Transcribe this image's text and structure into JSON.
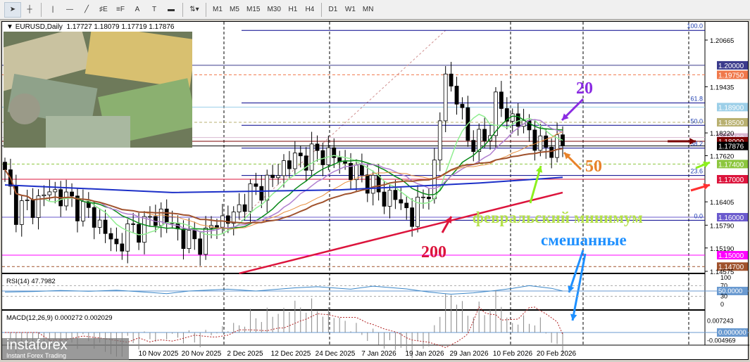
{
  "toolbar": {
    "tools": [
      {
        "name": "cursor",
        "glyph": "➤"
      },
      {
        "name": "crosshair",
        "glyph": "┼"
      },
      {
        "name": "vertical-line",
        "glyph": "|"
      },
      {
        "name": "horizontal-line",
        "glyph": "—"
      },
      {
        "name": "trendline",
        "glyph": "╱"
      },
      {
        "name": "fibo-channel",
        "glyph": "♯E"
      },
      {
        "name": "fibo-levels",
        "glyph": "≡F"
      },
      {
        "name": "text",
        "glyph": "A"
      },
      {
        "name": "text-label",
        "glyph": "T"
      },
      {
        "name": "rectangle",
        "glyph": "▬"
      },
      {
        "name": "arrows",
        "glyph": "⇅▾"
      }
    ],
    "timeframes": [
      "M1",
      "M5",
      "M15",
      "M30",
      "H1",
      "H4",
      "D1",
      "W1",
      "MN"
    ]
  },
  "symbol": {
    "label": "EURUSD,Daily",
    "open": "1.17727",
    "high": "1.18079",
    "low": "1.17719",
    "close": "1.17876"
  },
  "price_axis": {
    "ticks": [
      "1.20665",
      "1.19435",
      "1.18220",
      "1.17620",
      "1.16405",
      "1.15790",
      "1.15190",
      "1.14575"
    ],
    "min": 1.14575,
    "max": 1.20665
  },
  "levels": [
    {
      "price": 1.2,
      "label": "1.20000",
      "color": "#3b3b8c",
      "style": "solid"
    },
    {
      "price": 1.1975,
      "label": "1.19750",
      "color": "#f0784a",
      "style": "dash"
    },
    {
      "price": 1.189,
      "label": "1.18900",
      "color": "#9ccfe8",
      "style": "solid"
    },
    {
      "price": 1.185,
      "label": "1.18500",
      "color": "#b8b070",
      "style": "dash"
    },
    {
      "price": 1.181,
      "label": "1.18100",
      "color": "#d8b8d0",
      "style": "solid"
    },
    {
      "price": 1.18,
      "label": "1.18000",
      "color": "#7a0000",
      "style": "solid"
    },
    {
      "price": 1.17876,
      "label": "1.17876",
      "color": "#000000",
      "style": "solid"
    },
    {
      "price": 1.174,
      "label": "1.17400",
      "color": "#8cc63e",
      "style": "dash"
    },
    {
      "price": 1.17,
      "label": "1.17000",
      "color": "#dc143c",
      "style": "solid"
    },
    {
      "price": 1.16,
      "label": "1.16000",
      "color": "#6a5acd",
      "style": "solid"
    },
    {
      "price": 1.15,
      "label": "1.15000",
      "color": "#ff00ff",
      "style": "solid"
    },
    {
      "price": 1.147,
      "label": "1.14700",
      "color": "#a0522d",
      "style": "dash"
    }
  ],
  "fibo": [
    {
      "label": "100.0",
      "price": 1.2092
    },
    {
      "label": "61.8",
      "price": 1.1901
    },
    {
      "label": "50.0",
      "price": 1.1842
    },
    {
      "label": "38.2",
      "price": 1.1782
    },
    {
      "label": "23.6",
      "price": 1.171
    },
    {
      "label": "0.0",
      "price": 1.1592
    }
  ],
  "price_path": [
    [
      0,
      1.171
    ],
    [
      2,
      1.162
    ],
    [
      5,
      1.163
    ],
    [
      8,
      1.167
    ],
    [
      12,
      1.164
    ],
    [
      16,
      1.16
    ],
    [
      20,
      1.152
    ],
    [
      22,
      1.156
    ],
    [
      25,
      1.158
    ],
    [
      28,
      1.161
    ],
    [
      31,
      1.156
    ],
    [
      34,
      1.153
    ],
    [
      36,
      1.155
    ],
    [
      38,
      1.159
    ],
    [
      41,
      1.16
    ],
    [
      43,
      1.165
    ],
    [
      48,
      1.17
    ],
    [
      50,
      1.174
    ],
    [
      54,
      1.176
    ],
    [
      57,
      1.177
    ],
    [
      60,
      1.175
    ],
    [
      62,
      1.172
    ],
    [
      65,
      1.17
    ],
    [
      67,
      1.166
    ],
    [
      70,
      1.165
    ],
    [
      72,
      1.162
    ],
    [
      73,
      1.16
    ],
    [
      75,
      1.165
    ],
    [
      77,
      1.172
    ],
    [
      78,
      1.185
    ],
    [
      79,
      1.2
    ],
    [
      80,
      1.193
    ],
    [
      82,
      1.188
    ],
    [
      83,
      1.18
    ],
    [
      86,
      1.18
    ],
    [
      88,
      1.19
    ],
    [
      90,
      1.187
    ],
    [
      92,
      1.185
    ],
    [
      94,
      1.183
    ],
    [
      96,
      1.178
    ],
    [
      98,
      1.179
    ],
    [
      100,
      1.17876
    ]
  ],
  "ma200": [
    [
      42,
      1.1452
    ],
    [
      100,
      1.1665
    ]
  ],
  "ma100": [
    [
      0,
      1.1685
    ],
    [
      30,
      1.1665
    ],
    [
      60,
      1.1672
    ],
    [
      85,
      1.169
    ],
    [
      100,
      1.1705
    ]
  ],
  "rsi": {
    "label": "RSI(14) 47.7982",
    "levels": [
      "100",
      "70",
      "50.0000",
      "30",
      "0"
    ],
    "path": [
      [
        0,
        46
      ],
      [
        5,
        48
      ],
      [
        10,
        52
      ],
      [
        15,
        49
      ],
      [
        20,
        53
      ],
      [
        25,
        46
      ],
      [
        29,
        40
      ],
      [
        33,
        50
      ],
      [
        40,
        57
      ],
      [
        45,
        50
      ],
      [
        52,
        62
      ],
      [
        56,
        66
      ],
      [
        62,
        57
      ],
      [
        66,
        68
      ],
      [
        72,
        58
      ],
      [
        76,
        46
      ],
      [
        80,
        38
      ],
      [
        84,
        43
      ],
      [
        88,
        52
      ],
      [
        91,
        60
      ],
      [
        94,
        70
      ],
      [
        98,
        60
      ],
      [
        100,
        50
      ]
    ]
  },
  "macd": {
    "label": "MACD(12,26,9) 0.000272 0.002029",
    "ticks": [
      "0.007243",
      "0.000000",
      "-0.004969"
    ]
  },
  "dates": [
    "10 Nov 2025",
    "20 Nov 2025",
    "2 Dec 2025",
    "12 Dec 2025",
    "24 Dec 2025",
    "7 Jan 2026",
    "19 Jan 2026",
    "29 Jan 2026",
    "10 Feb 2026",
    "20 Feb 2026"
  ],
  "annotations": {
    "ma20": "20",
    "ma50": "50",
    "ma200": "200",
    "feb_min": "февральский минимум",
    "mixed": "смешанные"
  },
  "logo": {
    "name": "instaforex",
    "tagline": "Instant Forex Trading"
  }
}
